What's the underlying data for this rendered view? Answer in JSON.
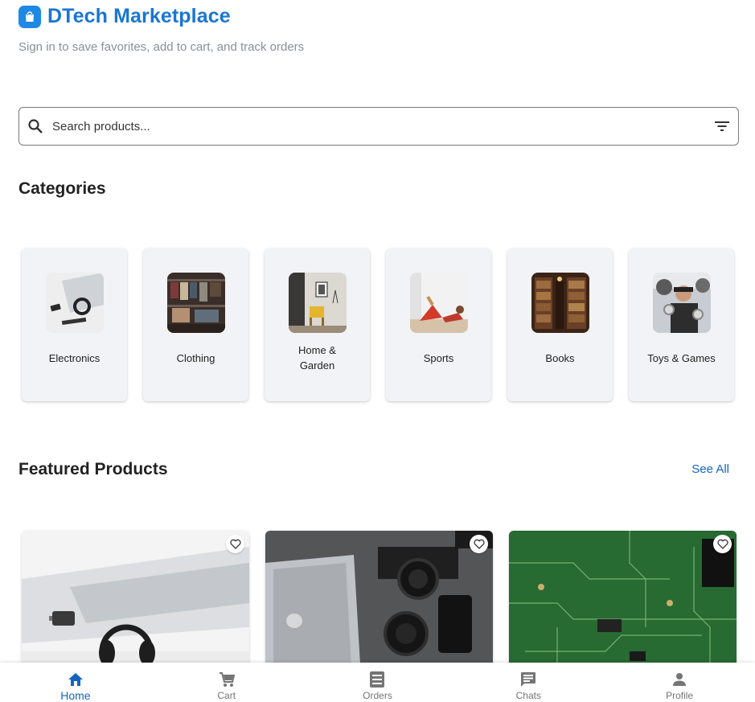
{
  "header": {
    "title": "DTech Marketplace",
    "subtitle": "Sign in to save favorites, add to cart, and track orders",
    "logo_icon": "shopping-bag-icon",
    "brand_color": "#1976d2"
  },
  "search": {
    "placeholder": "Search products...",
    "search_icon": "search-icon",
    "filter_icon": "filter-icon"
  },
  "categories": {
    "title": "Categories",
    "items": [
      {
        "label": "Electronics"
      },
      {
        "label": "Clothing"
      },
      {
        "label": "Home & Garden"
      },
      {
        "label": "Sports"
      },
      {
        "label": "Books"
      },
      {
        "label": "Toys & Games"
      }
    ]
  },
  "featured": {
    "title": "Featured Products",
    "see_all": "See All",
    "products": [
      {
        "image": "laptop-headphones-desk",
        "favorite_icon": "heart-outline-icon"
      },
      {
        "image": "camera-gear-laptop",
        "favorite_icon": "heart-outline-icon"
      },
      {
        "image": "circuit-board",
        "favorite_icon": "heart-outline-icon"
      }
    ]
  },
  "bottom_nav": {
    "active_color": "#1565c0",
    "items": [
      {
        "label": "Home",
        "icon": "home-icon",
        "active": true
      },
      {
        "label": "Cart",
        "icon": "cart-icon",
        "active": false
      },
      {
        "label": "Orders",
        "icon": "orders-icon",
        "active": false
      },
      {
        "label": "Chats",
        "icon": "chat-icon",
        "active": false
      },
      {
        "label": "Profile",
        "icon": "person-icon",
        "active": false
      }
    ]
  }
}
